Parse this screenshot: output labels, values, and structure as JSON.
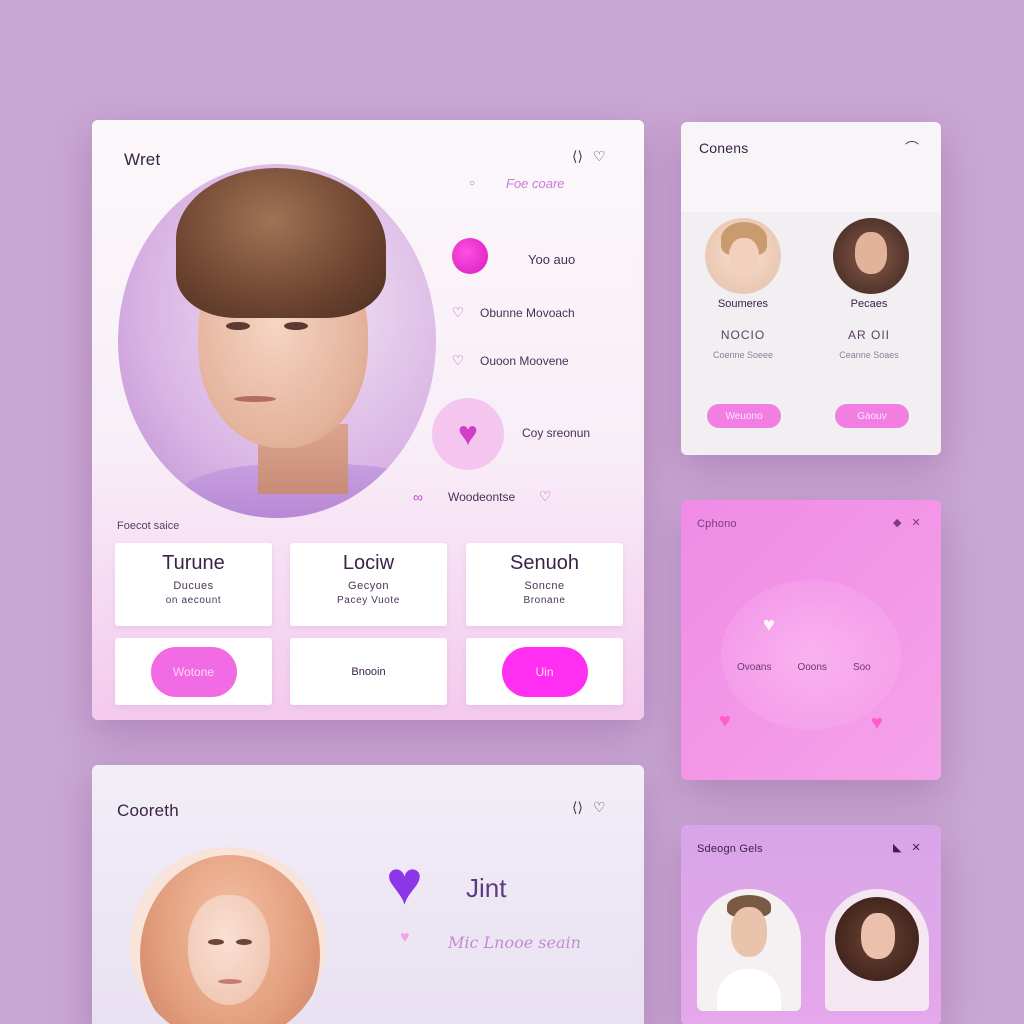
{
  "main_card": {
    "title": "Wret",
    "header_icons": [
      "double-arrow-icon",
      "heart-outline-icon"
    ],
    "tagline": "Foe coare",
    "side_items": [
      {
        "label": "Yoo auo",
        "icon": "heart-blob-icon"
      },
      {
        "label": "Obunne Movoach",
        "icon": "heart-outline-icon"
      },
      {
        "label": "Ouoon Moovene",
        "icon": "heart-outline-icon"
      },
      {
        "label": "Coy sreonun",
        "icon": "heart-badge-icon"
      },
      {
        "label": "Woodeontse",
        "icon": "heart-outline-icon"
      }
    ],
    "section_label": "Foecot saice",
    "stats": [
      {
        "title": "Turune",
        "sub": "Ducues",
        "sub2": "on aecount"
      },
      {
        "title": "Lociw",
        "sub": "Gecyon",
        "sub2": "Pacey Vuote"
      },
      {
        "title": "Senuoh",
        "sub": "Soncne",
        "sub2": "Bronane"
      }
    ],
    "actions": [
      {
        "label": "Wotone",
        "style": "soft"
      },
      {
        "label": "Bnooin",
        "style": "plain"
      },
      {
        "label": "Uin",
        "style": "hot"
      }
    ]
  },
  "contacts_card": {
    "title": "Conens",
    "contacts": [
      {
        "name": "Soumeres",
        "code": "NOCIO",
        "meta": "Coenne Soeee"
      },
      {
        "name": "Pecaes",
        "code": "AR OII",
        "meta": "Ceanne Soaes"
      }
    ],
    "buttons": [
      "Weuono",
      "Gaouv"
    ]
  },
  "pink_card": {
    "title": "Cphono",
    "tabs": [
      "Ovoans",
      "Ooons",
      "Soo"
    ]
  },
  "bottom_card": {
    "title": "Cooreth",
    "join_label": "Jint",
    "tagline": "Mic Lnooe seain"
  },
  "small_card": {
    "title": "Sdeogn Gels"
  },
  "colors": {
    "background": "#c9a6d3",
    "accent_pink": "#ff2ef0",
    "accent_purple": "#8b36e8"
  }
}
